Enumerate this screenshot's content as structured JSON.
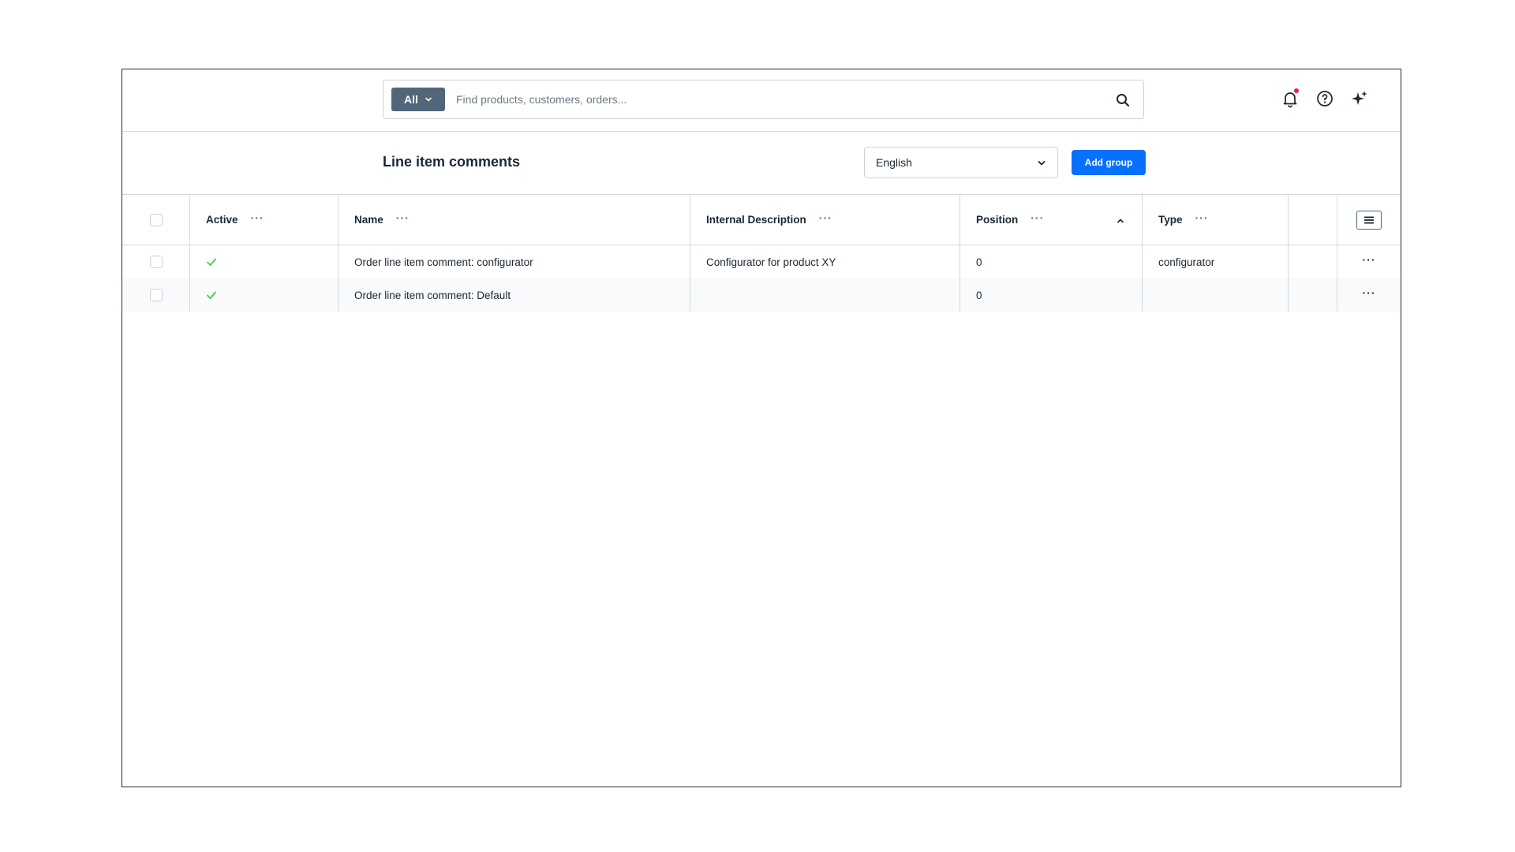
{
  "search": {
    "type_label": "All",
    "placeholder": "Find products, customers, orders..."
  },
  "header_icons": [
    "bell-icon",
    "help-icon",
    "sparkle-icon"
  ],
  "page": {
    "title": "Line item comments",
    "language": "English",
    "add_group_label": "Add group"
  },
  "table": {
    "columns": {
      "active": "Active",
      "name": "Name",
      "description": "Internal Description",
      "position": "Position",
      "type": "Type"
    },
    "sort": {
      "column": "Position",
      "direction": "ascending"
    },
    "rows": [
      {
        "active": true,
        "name": "Order line item comment: configurator",
        "description": "Configurator for product XY",
        "position": "0",
        "type": "configurator"
      },
      {
        "active": true,
        "name": "Order line item comment: Default",
        "description": "",
        "position": "0",
        "type": ""
      }
    ]
  },
  "colors": {
    "primary": "#0870ff",
    "search_type_bg": "#52667a",
    "active_check": "#37d046",
    "notification_dot": "#de294c"
  }
}
